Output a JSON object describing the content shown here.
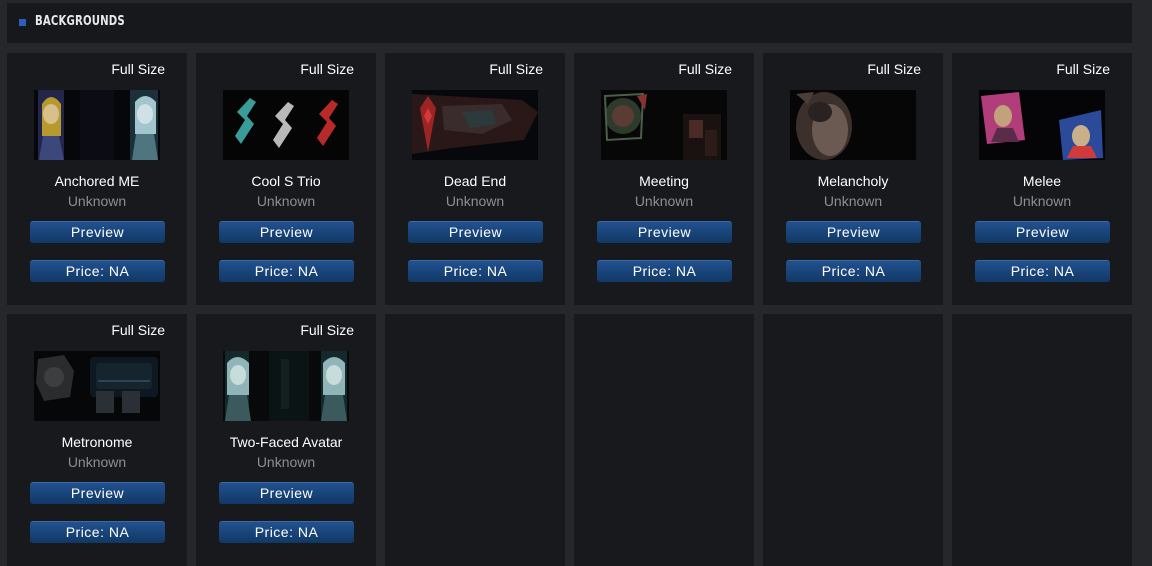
{
  "section": {
    "title": "BACKGROUNDS",
    "accent_color": "#2c5fb5"
  },
  "labels": {
    "full_size": "Full Size",
    "preview": "Preview"
  },
  "cards": [
    {
      "name": "Anchored ME",
      "author": "Unknown",
      "price": "Price: NA"
    },
    {
      "name": "Cool S Trio",
      "author": "Unknown",
      "price": "Price: NA"
    },
    {
      "name": "Dead End",
      "author": "Unknown",
      "price": "Price: NA"
    },
    {
      "name": "Meeting",
      "author": "Unknown",
      "price": "Price: NA"
    },
    {
      "name": "Melancholy",
      "author": "Unknown",
      "price": "Price: NA"
    },
    {
      "name": "Melee",
      "author": "Unknown",
      "price": "Price: NA"
    },
    {
      "name": "Metronome",
      "author": "Unknown",
      "price": "Price: NA"
    },
    {
      "name": "Two-Faced Avatar",
      "author": "Unknown",
      "price": "Price: NA"
    }
  ]
}
